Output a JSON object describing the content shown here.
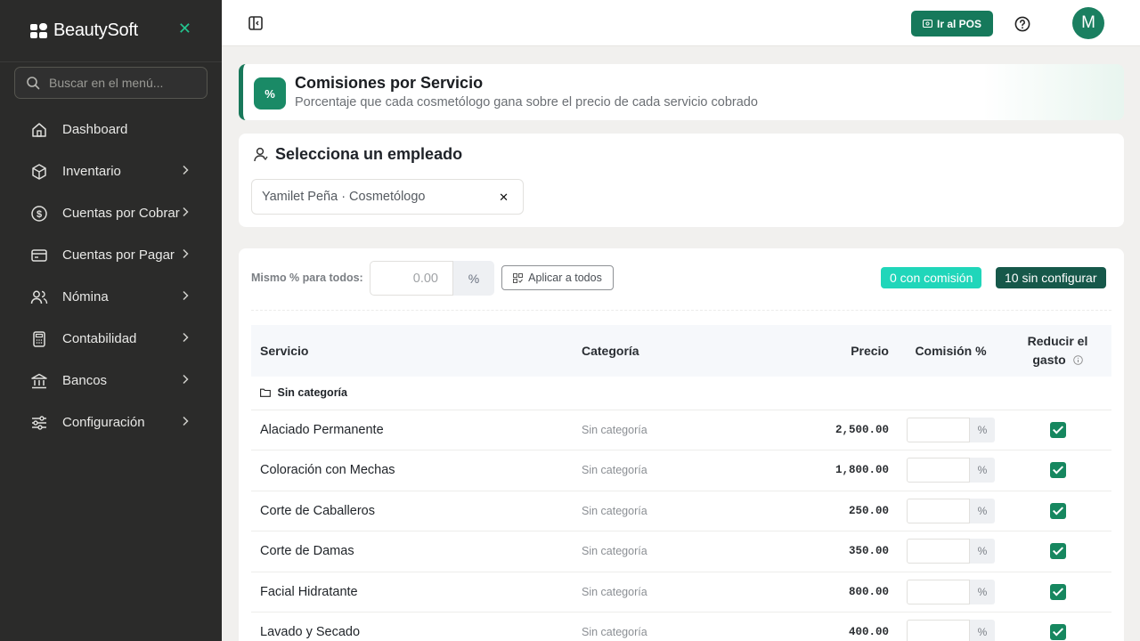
{
  "brand": {
    "name": "BeautySoft"
  },
  "search": {
    "placeholder": "Buscar en el menú..."
  },
  "nav": [
    {
      "label": "Dashboard",
      "icon": "home-icon",
      "has_children": false
    },
    {
      "label": "Inventario",
      "icon": "box-icon",
      "has_children": true
    },
    {
      "label": "Cuentas por Cobrar",
      "icon": "dollar-circle-icon",
      "has_children": true
    },
    {
      "label": "Cuentas por Pagar",
      "icon": "credit-card-icon",
      "has_children": true
    },
    {
      "label": "Nómina",
      "icon": "users-icon",
      "has_children": true
    },
    {
      "label": "Contabilidad",
      "icon": "calculator-icon",
      "has_children": true
    },
    {
      "label": "Bancos",
      "icon": "bank-icon",
      "has_children": true
    },
    {
      "label": "Configuración",
      "icon": "sliders-icon",
      "has_children": true
    }
  ],
  "topbar": {
    "pos_label": "Ir al POS",
    "avatar_initial": "M"
  },
  "header": {
    "icon_text": "%",
    "title": "Comisiones por Servicio",
    "subtitle": "Porcentaje que cada cosmetólogo gana sobre el precio de cada servicio cobrado"
  },
  "employee": {
    "title": "Selecciona un empleado",
    "selected": "Yamilet Peña · Cosmetólogo"
  },
  "bulk": {
    "label": "Mismo % para todos:",
    "placeholder": "0.00",
    "unit": "%",
    "apply_label": "Aplicar a todos",
    "with_commission": "0 con comisión",
    "unconfigured": "10 sin configurar"
  },
  "table": {
    "headers": {
      "service": "Servicio",
      "category": "Categoría",
      "price": "Precio",
      "commission": "Comisión %",
      "reduce_line1": "Reducir el",
      "reduce_line2": "gasto"
    },
    "group": "Sin categoría",
    "unit": "%",
    "rows": [
      {
        "service": "Alaciado Permanente",
        "category": "Sin categoría",
        "price": "2,500.00",
        "commission": "",
        "reduce": true
      },
      {
        "service": "Coloración con Mechas",
        "category": "Sin categoría",
        "price": "1,800.00",
        "commission": "",
        "reduce": true
      },
      {
        "service": "Corte de Caballeros",
        "category": "Sin categoría",
        "price": "250.00",
        "commission": "",
        "reduce": true
      },
      {
        "service": "Corte de Damas",
        "category": "Sin categoría",
        "price": "350.00",
        "commission": "",
        "reduce": true
      },
      {
        "service": "Facial Hidratante",
        "category": "Sin categoría",
        "price": "800.00",
        "commission": "",
        "reduce": true
      },
      {
        "service": "Lavado y Secado",
        "category": "Sin categoría",
        "price": "400.00",
        "commission": "",
        "reduce": true
      }
    ]
  },
  "colors": {
    "accent": "#16795b",
    "sidebar_bg": "#2b2b2a",
    "badge_on": "#20d6ba",
    "badge_off": "#16584a"
  }
}
